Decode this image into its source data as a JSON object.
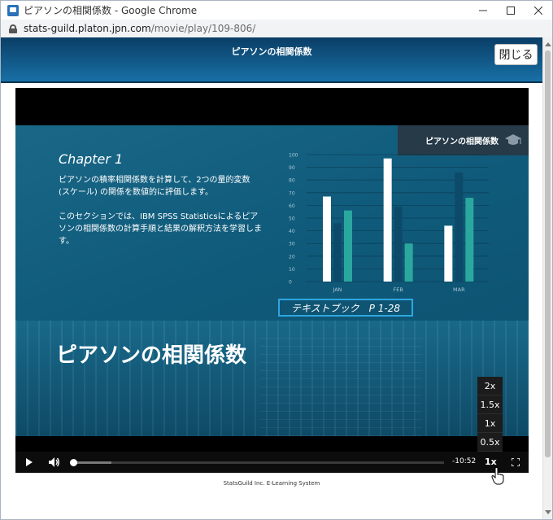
{
  "window": {
    "title": "ピアソンの相関係数 - Google Chrome",
    "url_host": "stats-guild.platon.jpn.com",
    "url_path": "/movie/play/109-806/"
  },
  "page": {
    "title": "ピアソンの相関係数",
    "close_label": "閉じる",
    "footer": "StatsGuild Inc. E-Learning System"
  },
  "slide": {
    "badge": "ピアソンの相関係数",
    "chapter": "Chapter 1",
    "paragraph1": "ピアソンの積率相関係数を計算して、2つの量的変数 (スケール) の関係を数値的に評価します。",
    "paragraph2": "このセクションでは、IBM SPSS Statisticsによるピアソンの相関係数の計算手順と結果の解釈方法を学習します。",
    "textbook": "テキストブック　P 1-28",
    "big_title": "ピアソンの相関係数"
  },
  "chart_data": {
    "type": "bar",
    "categories": [
      "JAN",
      "FEB",
      "MAR"
    ],
    "series": [
      {
        "values": [
          67,
          97,
          44
        ],
        "color": "#ffffff"
      },
      {
        "values": [
          46,
          59,
          86
        ],
        "color": "#0d4a6a"
      },
      {
        "values": [
          56,
          30,
          66
        ],
        "color": "#2aa79e"
      }
    ],
    "ylim": [
      0,
      100
    ],
    "yticks": [
      "0",
      "10",
      "20",
      "30",
      "40",
      "50",
      "60",
      "70",
      "80",
      "90",
      "100"
    ],
    "grid": true,
    "title": "",
    "xlabel": "",
    "ylabel": ""
  },
  "player": {
    "speeds": [
      "2x",
      "1.5x",
      "1x",
      "0.5x"
    ],
    "current_rate": "1x",
    "time_remaining": "-10:52",
    "progress_fraction": 0.11
  },
  "colors": {
    "header_dark": "#0a3e66",
    "header_light": "#1870a6",
    "textbook_border": "#2ea6e0"
  }
}
